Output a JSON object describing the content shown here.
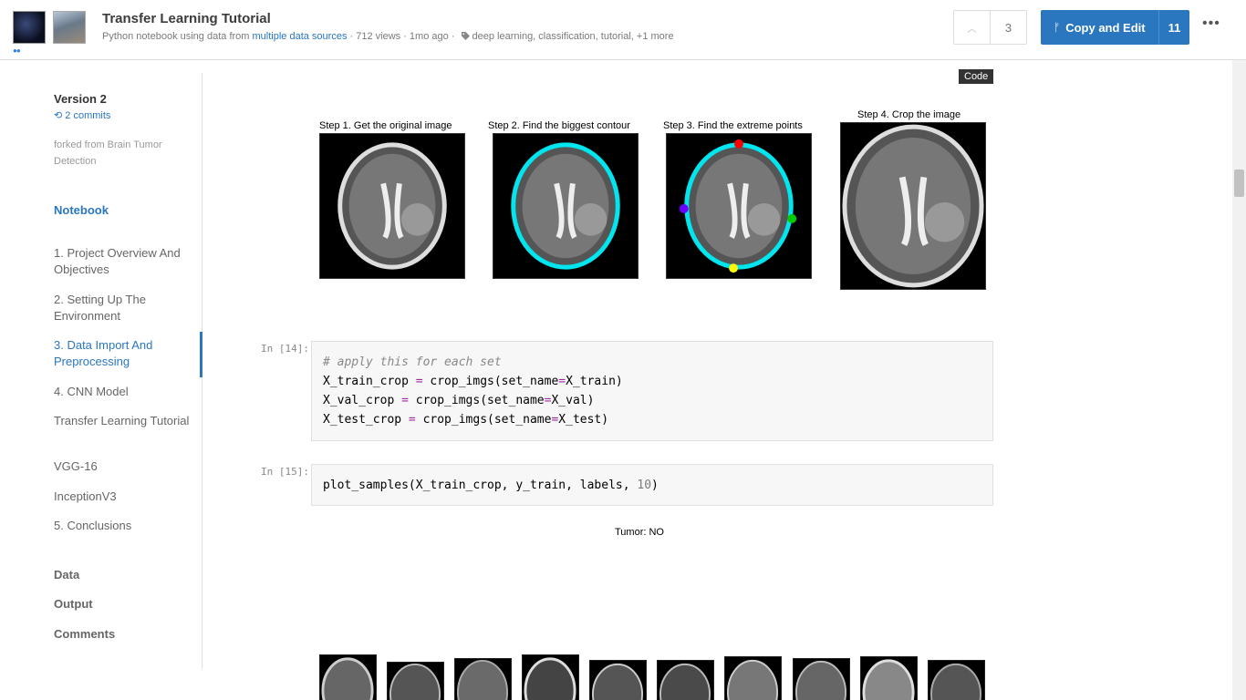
{
  "header": {
    "title": "Transfer Learning Tutorial",
    "subtitle_prefix": "Python notebook using data from ",
    "subtitle_link": "multiple data sources",
    "subtitle_stats": " · 712 views · 1mo ago · ",
    "tags": "deep learning, classification, tutorial,",
    "tags_more": " +1 more",
    "vote_count": "3",
    "copy_label": "Copy and Edit",
    "copy_count": "11",
    "more_label": "•••"
  },
  "sidebar": {
    "version": "Version 2",
    "commits": "2 commits",
    "forked_from": "forked from Brain Tumor Detection",
    "notebook_heading": "Notebook",
    "toc": [
      "1. Project Overview And Objectives",
      "2. Setting Up The Environment",
      "3. Data Import And Preprocessing",
      "4. CNN Model",
      "Transfer Learning Tutorial",
      "VGG-16",
      "InceptionV3",
      "5. Conclusions"
    ],
    "sections": [
      "Data",
      "Output",
      "Comments"
    ]
  },
  "main": {
    "code_tooltip": "Code",
    "steps": [
      "Step 1. Get the original image",
      "Step 2. Find the biggest contour",
      "Step 3. Find the extreme points",
      "Step 4. Crop the image"
    ],
    "cell14": {
      "prompt": "In [14]:",
      "comment": "# apply this for each set",
      "lines": [
        {
          "lhs": "X_train_crop ",
          "op": "=",
          "mid": " crop_imgs(set_name",
          "op2": "=",
          "rhs": "X_train)"
        },
        {
          "lhs": "X_val_crop ",
          "op": "=",
          "mid": " crop_imgs(set_name",
          "op2": "=",
          "rhs": "X_val)"
        },
        {
          "lhs": "X_test_crop ",
          "op": "=",
          "mid": " crop_imgs(set_name",
          "op2": "=",
          "rhs": "X_test)"
        }
      ]
    },
    "cell15": {
      "prompt": "In [15]:",
      "code": "plot_samples(X_train_crop, y_train, labels, ",
      "num": "10",
      "close": ")"
    },
    "output_label": "Tumor: NO"
  }
}
